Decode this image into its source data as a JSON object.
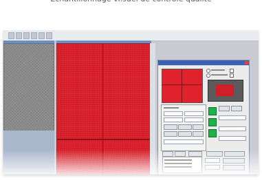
{
  "caption": "Echantillonnage vi.suel de contrôle qualité",
  "colors": {
    "accent_red": "#d9202c",
    "gray_texture": "#8b8b8b",
    "dialog_title": "#3b62b5",
    "status_green": "#1fb24a"
  },
  "icons": [
    "toolbar-button-icon",
    "close-icon"
  ]
}
